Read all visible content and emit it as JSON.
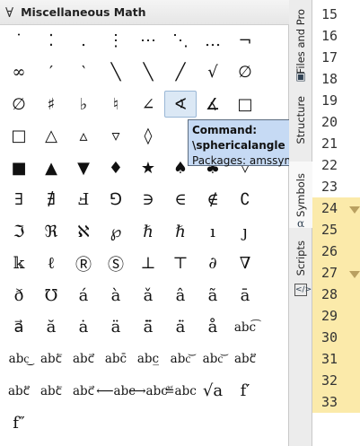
{
  "panel": {
    "glyph": "∀",
    "title": "Miscellaneous Math"
  },
  "symbols": [
    [
      "˙",
      "⁚",
      "․",
      "⋮",
      "⋯",
      "⋱",
      "…",
      "¬"
    ],
    [
      "∞",
      "′",
      "‵",
      "╲",
      "╲",
      "╱",
      "√",
      "∅"
    ],
    [
      "∅",
      "♯",
      "♭",
      "♮",
      "∠",
      "∢",
      "∡",
      "□"
    ],
    [
      "□",
      "△",
      "▵",
      "▿",
      "◊",
      "",
      "",
      "▿"
    ],
    [
      "■",
      "▲",
      "▼",
      "♦",
      "★",
      "♠",
      "♣",
      "▿"
    ],
    [
      "∃",
      "∄",
      "Ⅎ",
      "⅁",
      "∋",
      "∈",
      "∉",
      "∁"
    ],
    [
      "ℑ",
      "ℜ",
      "ℵ",
      "℘",
      "ℏ",
      "ℏ",
      "ı",
      "ȷ"
    ],
    [
      "𝕜",
      "ℓ",
      "Ⓡ",
      "Ⓢ",
      "⊥",
      "⊤",
      "∂",
      "∇"
    ],
    [
      "ð",
      "℧",
      "á",
      "à",
      "ǎ",
      "â",
      "ã",
      "ā"
    ],
    [
      "a⃗",
      "ă",
      "ȧ",
      "ä",
      "ä̈",
      "ȧ̈",
      "å",
      "abc͡"
    ],
    [
      "abc͜",
      "abc⃖",
      "abc⃗",
      "abc̄",
      "abc̲",
      "abc͝",
      "abc͝",
      "abc⃡"
    ],
    [
      "abc⃡",
      "abc⃖",
      "abc⃗",
      "⟵abc",
      "⟶abc",
      "≝abc",
      "√a",
      "f′"
    ],
    [
      "f″"
    ]
  ],
  "tooltip": {
    "command": "Command: \\sphericalangle",
    "packages": "Packages: amssymb"
  },
  "tabs": {
    "files": "Files and Pro",
    "structure": "Structure",
    "symbols": "Symbols",
    "scripts": "Scripts"
  },
  "line_numbers": [
    "15",
    "16",
    "17",
    "18",
    "19",
    "20",
    "21",
    "22",
    "23",
    "24",
    "25",
    "26",
    "27",
    "28",
    "29",
    "30",
    "31",
    "32",
    "33"
  ]
}
